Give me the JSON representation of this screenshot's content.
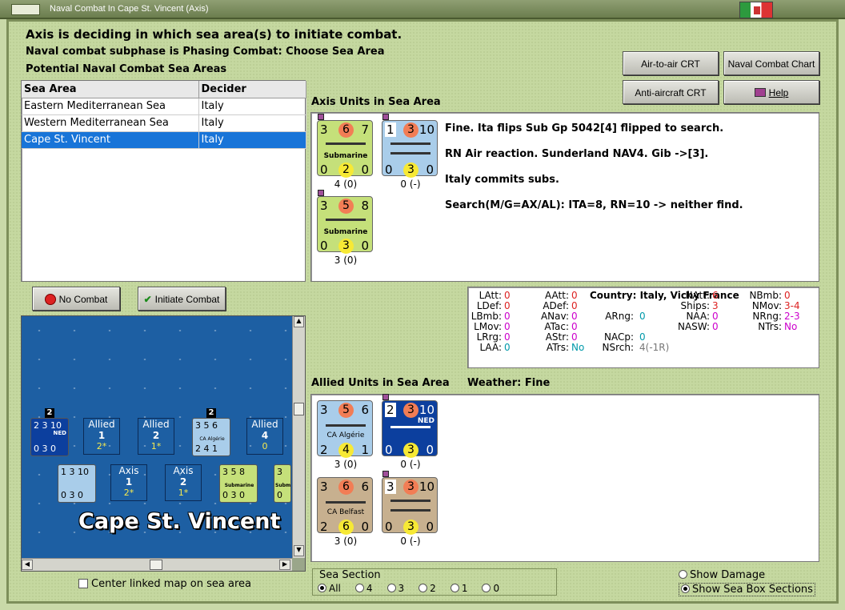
{
  "window": {
    "title": "Naval Combat In Cape St. Vincent (Axis)"
  },
  "header": {
    "line1": "Axis is deciding in which sea area(s) to initiate combat.",
    "line2": "Naval combat subphase is Phasing Combat: Choose Sea Area",
    "line3": "Potential Naval Combat Sea Areas"
  },
  "buttons": {
    "air_to_air": "Air-to-air CRT",
    "naval_chart": "Naval Combat Chart",
    "anti_aircraft": "Anti-aircraft CRT",
    "help": "Help",
    "no_combat": "No Combat",
    "initiate_combat": "Initiate Combat"
  },
  "sea_table": {
    "col_area": "Sea Area",
    "col_decider": "Decider",
    "rows": [
      {
        "area": "Eastern Mediterranean Sea",
        "decider": "Italy"
      },
      {
        "area": "Western Mediterranean Sea",
        "decider": "Italy"
      },
      {
        "area": "Cape St. Vincent",
        "decider": "Italy"
      }
    ]
  },
  "axis_units": {
    "label": "Axis Units in Sea Area",
    "counters": [
      {
        "tl": "3",
        "tc": "6",
        "tr": "7",
        "name": "Submarine",
        "bl": "0",
        "bc": "2",
        "br": "0",
        "count": "4 (0)"
      },
      {
        "tl": "1",
        "tc": "3",
        "tr": "10",
        "name": "",
        "bl": "0",
        "bc": "3",
        "br": "0",
        "count": "0 (-)"
      },
      {
        "tl": "3",
        "tc": "5",
        "tr": "8",
        "name": "Submarine",
        "bl": "0",
        "bc": "3",
        "br": "0",
        "count": "3 (0)"
      }
    ]
  },
  "log": [
    "Fine.  Ita flips Sub Gp 5042[4] flipped to search.",
    "RN Air reaction.  Sunderland NAV4.  Gib ->[3].",
    "Italy commits subs.",
    "Search(M/G=AX/AL):  ITA=8, RN=10 -> neither find."
  ],
  "stats": {
    "country": "Country: Italy, Vichy France",
    "col1": [
      [
        "LAtt:",
        "0"
      ],
      [
        "LDef:",
        "0"
      ],
      [
        "LBmb:",
        "0"
      ],
      [
        "LMov:",
        "0"
      ],
      [
        "LRrg:",
        "0"
      ],
      [
        "LAA:",
        "0"
      ]
    ],
    "col2": [
      [
        "AAtt:",
        "0"
      ],
      [
        "ADef:",
        "0"
      ],
      [
        "ANav:",
        "0"
      ],
      [
        "ATac:",
        "0"
      ],
      [
        "AStr:",
        "0"
      ],
      [
        "ATrs:",
        "No"
      ]
    ],
    "col3": [
      [
        "ARng:",
        "0"
      ],
      [
        "NACp:",
        "0"
      ],
      [
        "NSrch:",
        "4(-1R)"
      ]
    ],
    "col4": [
      [
        "NAtt:",
        "6"
      ],
      [
        "Ships:",
        "3"
      ],
      [
        "NAA:",
        "0"
      ],
      [
        "NASW:",
        "0"
      ]
    ],
    "col5": [
      [
        "NBmb:",
        "0"
      ],
      [
        "NMov:",
        "3-4"
      ],
      [
        "NRng:",
        "2-3"
      ],
      [
        "NTrs:",
        "No"
      ]
    ]
  },
  "allied_units": {
    "label": "Allied Units in Sea Area",
    "weather": "Weather:  Fine",
    "counters": [
      {
        "tl": "3",
        "tc": "5",
        "tr": "6",
        "name": "CA Algérie",
        "bl": "2",
        "bc": "4",
        "br": "1",
        "count": "3 (0)"
      },
      {
        "tl": "2",
        "tc": "3",
        "tr": "10",
        "name": "NED",
        "bl": "0",
        "bc": "3",
        "br": "0",
        "count": "0 (-)"
      },
      {
        "tl": "3",
        "tc": "6",
        "tr": "6",
        "name": "CA Belfast",
        "bl": "2",
        "bc": "6",
        "br": "0",
        "count": "3 (0)"
      },
      {
        "tl": "3",
        "tc": "3",
        "tr": "10",
        "name": "",
        "bl": "0",
        "bc": "3",
        "br": "0",
        "count": "0 (-)"
      }
    ]
  },
  "map": {
    "sea_name": "Cape St. Vincent",
    "boxes": [
      {
        "side": "Allied",
        "num": "1",
        "sub": "2*"
      },
      {
        "side": "Allied",
        "num": "2",
        "sub": "1*"
      },
      {
        "side": "Allied",
        "num": "4",
        "sub": "0"
      },
      {
        "side": "Axis",
        "num": "1",
        "sub": "2*"
      },
      {
        "side": "Axis",
        "num": "2",
        "sub": "1*"
      }
    ],
    "stack_labels": [
      "2",
      "2"
    ],
    "mini_counters": [
      {
        "t": "2 3 10",
        "b": "0 3 0",
        "name": "NED"
      },
      {
        "t": "3 5 6",
        "b": "2 4 1",
        "name": "CA Algérie"
      },
      {
        "t": "1 3 10",
        "b": "0 3 0",
        "name": ""
      },
      {
        "t": "3 5 8",
        "b": "0 3 0",
        "name": "Submarine"
      },
      {
        "t": "3",
        "b": "0",
        "name": "Subm"
      }
    ],
    "center_linked": "Center linked map on sea area"
  },
  "sea_section": {
    "label": "Sea Section",
    "options": [
      "All",
      "4",
      "3",
      "2",
      "1",
      "0"
    ],
    "selected": "All"
  },
  "options": {
    "show_damage": "Show Damage",
    "show_sections": "Show Sea Box Sections"
  },
  "colors": {
    "selection": "#1874d8",
    "sea": "#1d5fa3",
    "sub_green": "#c5e07a",
    "french_blue": "#a9cdea",
    "ned_blue": "#0c3f9e",
    "uk_tan": "#c7b08f"
  }
}
